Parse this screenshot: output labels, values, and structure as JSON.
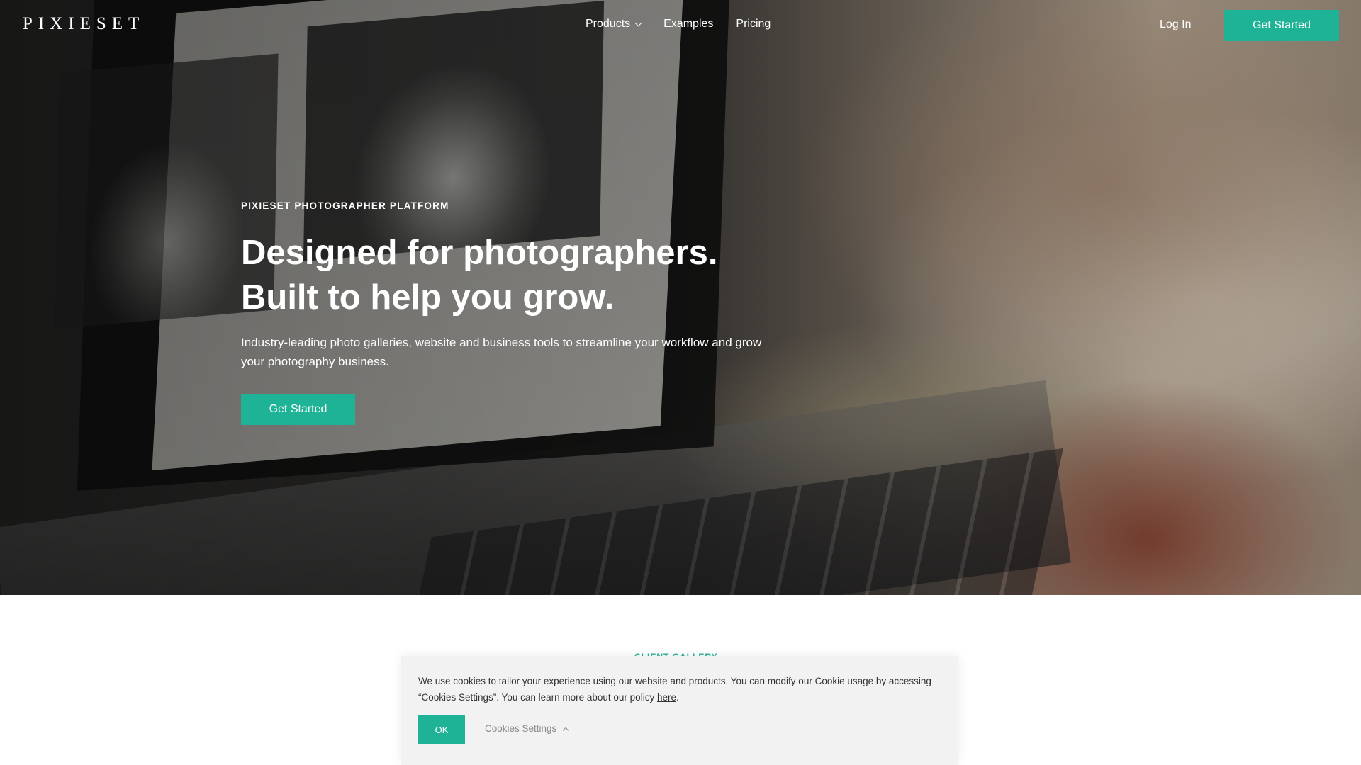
{
  "nav": {
    "logo": "PIXIESET",
    "links": [
      {
        "label": "Products",
        "has_dropdown": true,
        "icon": "chevron-down-icon"
      },
      {
        "label": "Examples"
      },
      {
        "label": "Pricing"
      }
    ],
    "login_label": "Log In",
    "cta_label": "Get Started"
  },
  "hero": {
    "eyebrow": "PIXIESET PHOTOGRAPHER PLATFORM",
    "headline_line1": "Designed for photographers.",
    "headline_line2": "Built to help you grow.",
    "subheadline": "Industry-leading photo galleries, website and business tools to streamline your workflow and grow your photography business.",
    "cta_label": "Get Started"
  },
  "next_section": {
    "eyebrow_partial": "CLIENT GALLERY"
  },
  "cookie_banner": {
    "text_before_link": "We use cookies to tailor your experience using our website and products. You can modify our Cookie usage by accessing “Cookies Settings”. You can learn more about our policy ",
    "link_label": "here",
    "text_after_link": ".",
    "ok_label": "OK",
    "settings_label": "Cookies Settings",
    "settings_icon": "chevron-up-icon"
  },
  "colors": {
    "accent": "#1eb396",
    "hero_text": "#ffffff",
    "banner_bg": "#f2f2f2"
  }
}
